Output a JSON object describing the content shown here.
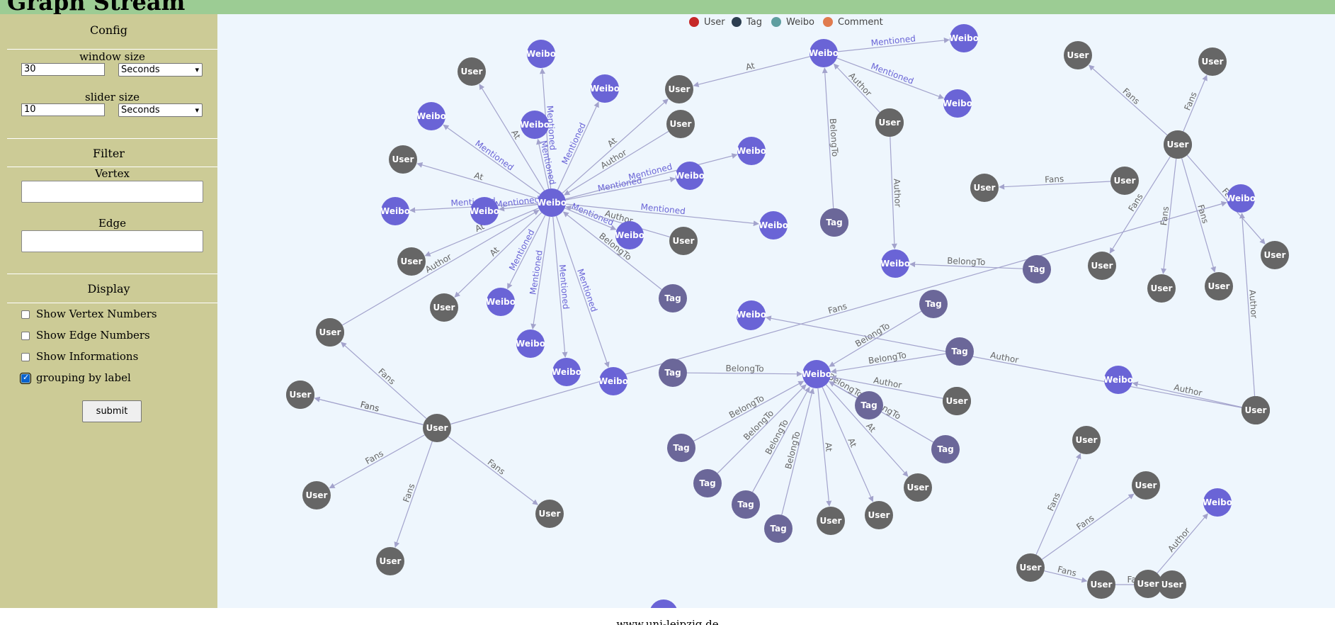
{
  "header": {
    "title": "Graph Stream"
  },
  "sidebar": {
    "config": {
      "title": "Config",
      "window_label": "window size",
      "window_value": "30",
      "window_unit": "Seconds",
      "slider_label": "slider size",
      "slider_value": "10",
      "slider_unit": "Seconds"
    },
    "filter": {
      "title": "Filter",
      "vertex_label": "Vertex",
      "vertex_value": "",
      "edge_label": "Edge",
      "edge_value": ""
    },
    "display": {
      "title": "Display",
      "options": [
        {
          "label": "Show Vertex Numbers",
          "checked": false
        },
        {
          "label": "Show Edge Numbers",
          "checked": false
        },
        {
          "label": "Show Informations",
          "checked": false
        },
        {
          "label": "grouping by label",
          "checked": true
        }
      ],
      "submit_label": "submit"
    }
  },
  "legend": [
    {
      "label": "User",
      "color": "#c62828"
    },
    {
      "label": "Tag",
      "color": "#2c3e50"
    },
    {
      "label": "Weibo",
      "color": "#5f9ea0"
    },
    {
      "label": "Comment",
      "color": "#e07b4f"
    }
  ],
  "colors": {
    "user": "#666666",
    "tag": "#6b6799",
    "weibo": "#6a64d6",
    "edge": "#a3a3cc",
    "edge_label_plain": "#666666",
    "edge_label_mentioned": "#6a64d6"
  },
  "graph": {
    "nodes": [
      {
        "id": "w1",
        "label": "Weibo"
      },
      {
        "id": "w2",
        "label": "Weibo"
      },
      {
        "id": "w3",
        "label": "Weibo"
      },
      {
        "id": "w4",
        "label": "Weibo"
      },
      {
        "id": "w5",
        "label": "Weibo"
      },
      {
        "id": "w6",
        "label": "Weibo"
      },
      {
        "id": "w7",
        "label": "Weibo"
      },
      {
        "id": "w8",
        "label": "Weibo"
      },
      {
        "id": "w9",
        "label": "Weibo"
      },
      {
        "id": "w10",
        "label": "Weibo"
      },
      {
        "id": "w11",
        "label": "Weibo"
      },
      {
        "id": "w12",
        "label": "Weibo"
      },
      {
        "id": "w13",
        "label": "Weibo"
      },
      {
        "id": "w14",
        "label": "Weibo"
      },
      {
        "id": "w15",
        "label": "Weibo"
      },
      {
        "id": "w16",
        "label": "Weibo"
      },
      {
        "id": "w17",
        "label": "Weibo"
      },
      {
        "id": "w18",
        "label": "Weibo"
      },
      {
        "id": "w19",
        "label": "Weibo"
      },
      {
        "id": "w20",
        "label": "Weibo"
      },
      {
        "id": "w21",
        "label": "Weibo"
      },
      {
        "id": "w22",
        "label": "Weibo"
      },
      {
        "id": "w23",
        "label": "Weibo"
      },
      {
        "id": "w24",
        "label": "Weibo"
      },
      {
        "id": "w25",
        "label": "Weibo"
      },
      {
        "id": "w26",
        "label": "Weibo"
      },
      {
        "id": "u1",
        "label": "User"
      },
      {
        "id": "u2",
        "label": "User"
      },
      {
        "id": "u3",
        "label": "User"
      },
      {
        "id": "u4",
        "label": "User"
      },
      {
        "id": "u5",
        "label": "User"
      },
      {
        "id": "u6",
        "label": "User"
      },
      {
        "id": "u7",
        "label": "User"
      },
      {
        "id": "u8",
        "label": "User"
      },
      {
        "id": "u9",
        "label": "User"
      },
      {
        "id": "u10",
        "label": "User"
      },
      {
        "id": "u11",
        "label": "User"
      },
      {
        "id": "u12",
        "label": "User"
      },
      {
        "id": "u13",
        "label": "User"
      },
      {
        "id": "u14",
        "label": "User"
      },
      {
        "id": "u15",
        "label": "User"
      },
      {
        "id": "u16",
        "label": "User"
      },
      {
        "id": "u17",
        "label": "User"
      },
      {
        "id": "u18",
        "label": "User"
      },
      {
        "id": "u19",
        "label": "User"
      },
      {
        "id": "u20",
        "label": "User"
      },
      {
        "id": "u21",
        "label": "User"
      },
      {
        "id": "u22",
        "label": "User"
      },
      {
        "id": "u23",
        "label": "User"
      },
      {
        "id": "u24",
        "label": "User"
      },
      {
        "id": "u25",
        "label": "User"
      },
      {
        "id": "u26",
        "label": "User"
      },
      {
        "id": "u27",
        "label": "User"
      },
      {
        "id": "u28",
        "label": "User"
      },
      {
        "id": "u29",
        "label": "User"
      },
      {
        "id": "u30",
        "label": "User"
      },
      {
        "id": "u31",
        "label": "User"
      },
      {
        "id": "u32",
        "label": "User"
      },
      {
        "id": "u33",
        "label": "User"
      },
      {
        "id": "u34",
        "label": "User"
      },
      {
        "id": "u35",
        "label": "User"
      },
      {
        "id": "u36",
        "label": "User"
      },
      {
        "id": "u37",
        "label": "User"
      },
      {
        "id": "u38",
        "label": "User"
      },
      {
        "id": "u39",
        "label": "User"
      },
      {
        "id": "u40",
        "label": "User"
      },
      {
        "id": "u41",
        "label": "User"
      },
      {
        "id": "t1",
        "label": "Tag"
      },
      {
        "id": "t2",
        "label": "Tag"
      },
      {
        "id": "t3",
        "label": "Tag"
      },
      {
        "id": "t4",
        "label": "Tag"
      },
      {
        "id": "t5",
        "label": "Tag"
      },
      {
        "id": "t6",
        "label": "Tag"
      },
      {
        "id": "t7",
        "label": "Tag"
      },
      {
        "id": "t8",
        "label": "Tag"
      },
      {
        "id": "t9",
        "label": "Tag"
      },
      {
        "id": "t10",
        "label": "Tag"
      },
      {
        "id": "t11",
        "label": "Tag"
      },
      {
        "id": "t12",
        "label": "Tag"
      },
      {
        "id": "t13",
        "label": "Tag"
      }
    ],
    "edges": [
      {
        "from": "w2",
        "to": "u1",
        "label": "At"
      },
      {
        "from": "w2",
        "to": "w3",
        "label": "Mentioned"
      },
      {
        "from": "w2",
        "to": "u3",
        "label": "At"
      },
      {
        "from": "w2",
        "to": "w4",
        "label": "Mentioned"
      },
      {
        "from": "w2",
        "to": "w6",
        "label": "Mentioned"
      },
      {
        "from": "w2",
        "to": "w7",
        "label": "Mentioned"
      },
      {
        "from": "w2",
        "to": "w8",
        "label": "Mentioned"
      },
      {
        "from": "w2",
        "to": "u4",
        "label": "At"
      },
      {
        "from": "u6",
        "to": "w2",
        "label": "Author"
      },
      {
        "from": "w2",
        "to": "w12",
        "label": "Mentioned"
      },
      {
        "from": "w2",
        "to": "w13",
        "label": "Mentioned"
      },
      {
        "from": "w2",
        "to": "w14",
        "label": "Mentioned"
      },
      {
        "from": "w2",
        "to": "w15",
        "label": "Mentioned"
      },
      {
        "from": "w2",
        "to": "w16",
        "label": "Mentioned"
      },
      {
        "from": "w2",
        "to": "w17",
        "label": "Mentioned"
      },
      {
        "from": "w2",
        "to": "w9",
        "label": "Mentioned"
      },
      {
        "from": "w2",
        "to": "w10",
        "label": "Mentioned"
      },
      {
        "from": "w2",
        "to": "w11",
        "label": "Mentioned"
      },
      {
        "from": "w2",
        "to": "u2",
        "label": "At"
      },
      {
        "from": "u8",
        "to": "w2",
        "label": "Author"
      },
      {
        "from": "t2",
        "to": "w2",
        "label": "BelongTo"
      },
      {
        "from": "u7",
        "to": "w2",
        "label": "Author"
      },
      {
        "from": "w2",
        "to": "u5",
        "label": "At"
      },
      {
        "from": "u9",
        "to": "w1",
        "label": "Author"
      },
      {
        "from": "w1",
        "to": "u3",
        "label": "At"
      },
      {
        "from": "w1",
        "to": "w18",
        "label": "Mentioned"
      },
      {
        "from": "w1",
        "to": "w19",
        "label": "Mentioned"
      },
      {
        "from": "t5",
        "to": "w1",
        "label": "BelongTo"
      },
      {
        "from": "t6",
        "to": "w21",
        "label": "BelongTo"
      },
      {
        "from": "t3",
        "to": "w5",
        "label": "BelongTo"
      },
      {
        "from": "t4",
        "to": "w5",
        "label": "BelongTo"
      },
      {
        "from": "t7",
        "to": "w5",
        "label": "BelongTo"
      },
      {
        "from": "t8",
        "to": "w5",
        "label": "BelongTo"
      },
      {
        "from": "t9",
        "to": "w5",
        "label": "BelongTo"
      },
      {
        "from": "t10",
        "to": "w5",
        "label": "BelongTo"
      },
      {
        "from": "t11",
        "to": "w5",
        "label": "BelongTo"
      },
      {
        "from": "t12",
        "to": "w5",
        "label": "BelongTo"
      },
      {
        "from": "t13",
        "to": "w5",
        "label": "BelongTo"
      },
      {
        "from": "u14",
        "to": "w5",
        "label": "Author"
      },
      {
        "from": "w5",
        "to": "u16",
        "label": "At"
      },
      {
        "from": "w5",
        "to": "u17",
        "label": "At"
      },
      {
        "from": "w5",
        "to": "u18",
        "label": "At"
      },
      {
        "from": "u10",
        "to": "w21",
        "label": "Author"
      },
      {
        "from": "u11",
        "to": "u12",
        "label": "Fans"
      },
      {
        "from": "u11",
        "to": "u13",
        "label": "Fans"
      },
      {
        "from": "u11",
        "to": "u19",
        "label": "Fans"
      },
      {
        "from": "u11",
        "to": "u20",
        "label": "Fans"
      },
      {
        "from": "u11",
        "to": "u21",
        "label": "Fans"
      },
      {
        "from": "u11",
        "to": "u22",
        "label": "Fans"
      },
      {
        "from": "u11",
        "to": "w22",
        "label": "Fans"
      },
      {
        "from": "u23",
        "to": "w22",
        "label": "Author"
      },
      {
        "from": "u24",
        "to": "u25",
        "label": "Fans"
      },
      {
        "from": "u26",
        "to": "u27",
        "label": "Fans"
      },
      {
        "from": "u26",
        "to": "u28",
        "label": "Fans"
      },
      {
        "from": "u26",
        "to": "u29",
        "label": "Fans"
      },
      {
        "from": "u26",
        "to": "u30",
        "label": "Fans"
      },
      {
        "from": "u31",
        "to": "u32",
        "label": "Fans"
      },
      {
        "from": "u33",
        "to": "w24",
        "label": "Author"
      },
      {
        "from": "u34",
        "to": "u35",
        "label": "Fans"
      },
      {
        "from": "u34",
        "to": "u36",
        "label": "Fans"
      },
      {
        "from": "u34",
        "to": "u37",
        "label": "Fans"
      },
      {
        "from": "u37",
        "to": "u38",
        "label": "Fans"
      },
      {
        "from": "u39",
        "to": "w25",
        "label": "Author"
      },
      {
        "from": "u40",
        "to": "w26",
        "label": "Author"
      },
      {
        "from": "u24",
        "to": "u41",
        "label": "Fans"
      }
    ]
  },
  "footer": {
    "text": "www.uni-leipzig.de"
  }
}
